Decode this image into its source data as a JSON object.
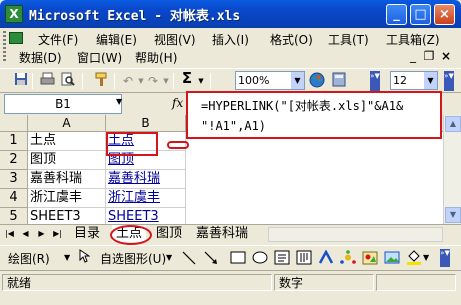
{
  "window": {
    "title": "Microsoft Excel - 对帐表.xls",
    "icon_letter": "X"
  },
  "window_controls": {
    "minimize": "_",
    "maximize": "□",
    "close": "×"
  },
  "menu": {
    "row1": [
      "文件(F)",
      "编辑(E)",
      "视图(V)",
      "插入(I)",
      "格式(O)",
      "工具(T)",
      "工具箱(Z)"
    ],
    "row2": [
      "数据(D)",
      "窗口(W)",
      "帮助(H)"
    ],
    "mdi": {
      "minimize": "_",
      "restore": "❐",
      "close": "×"
    }
  },
  "toolbar": {
    "zoom": "100%",
    "font_size": "12",
    "sum_icon": "Σ"
  },
  "formula_bar": {
    "name_box": "B1",
    "fx": "fx"
  },
  "grid": {
    "column_headers": [
      "A",
      "B"
    ],
    "rows": [
      {
        "num": "1",
        "a": "土点",
        "b": "土点"
      },
      {
        "num": "2",
        "a": "图顶",
        "b": "图顶"
      },
      {
        "num": "3",
        "a": "嘉善科瑞",
        "b": "嘉善科瑞"
      },
      {
        "num": "4",
        "a": "浙江虞丰",
        "b": "浙江虞丰"
      },
      {
        "num": "5",
        "a": "SHEET3",
        "b": "SHEET3"
      }
    ]
  },
  "formula_popup": {
    "line1": "=HYPERLINK(\"[对帐表.xls]\"&A1&",
    "line2": "\"!A1\",A1)"
  },
  "sheet_tabs": [
    "目录",
    "土点",
    "图顶",
    "嘉善科瑞"
  ],
  "active_tab": "土点",
  "draw_toolbar": {
    "draw_label": "绘图(R)",
    "autoshape_label": "自选图形(U)"
  },
  "status": {
    "ready": "就绪",
    "mode": "数字"
  },
  "colors": {
    "accent_red": "#d4161c",
    "link_blue": "#00009c",
    "title_blue": "#0a46c8"
  }
}
